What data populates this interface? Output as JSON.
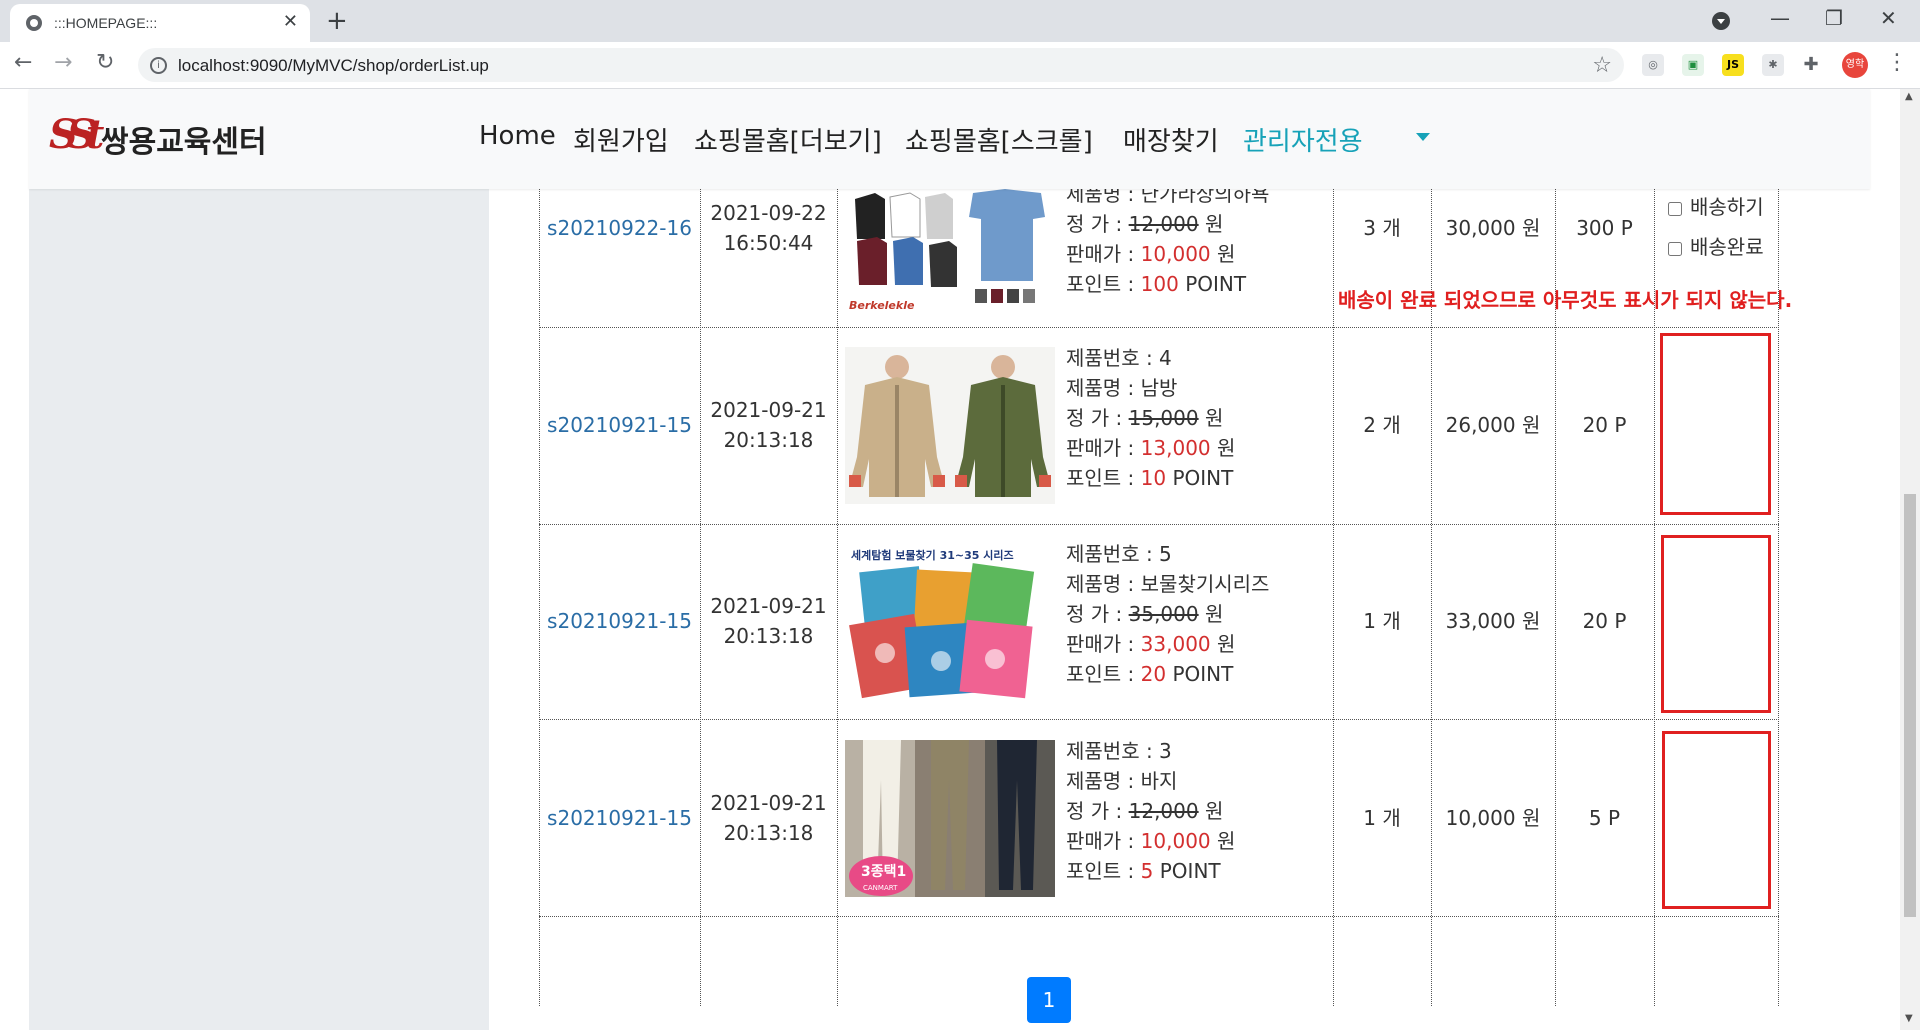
{
  "browser": {
    "tab_title": ":::HOMEPAGE:::",
    "url": "localhost:9090/MyMVC/shop/orderList.up",
    "profile_label": "영학",
    "ext_js_label": "JS"
  },
  "site": {
    "logo_text": "쌍용교육센터",
    "nav": [
      "Home",
      "회원가입",
      "쇼핑몰홈[더보기]",
      "쇼핑몰홈[스크롤]",
      "매장찾기",
      "관리자전용"
    ]
  },
  "orders": [
    {
      "code": "s20210922-16",
      "date": "2021-09-22",
      "time": "16:50:44",
      "image": "tshirts",
      "product_name_line": "제품명 : 난가라상의하욕",
      "price_label": "정 가 : ",
      "price": "12,000",
      "sale_label": "판매가 : ",
      "sale_price": "10,000",
      "won": " 원",
      "point_label": "포인트 : ",
      "point": "100",
      "point_unit": " POINT",
      "qty": "3 개",
      "total": "30,000 원",
      "order_point": "300 P"
    },
    {
      "code": "s20210921-15",
      "date": "2021-09-21",
      "time": "20:13:18",
      "image": "jackets",
      "product_no_line": "제품번호 : 4",
      "product_name_line": "제품명 : 남방",
      "price_label": "정 가 : ",
      "price": "15,000",
      "sale_label": "판매가 : ",
      "sale_price": "13,000",
      "won": " 원",
      "point_label": "포인트 : ",
      "point": "10",
      "point_unit": " POINT",
      "qty": "2 개",
      "total": "26,000 원",
      "order_point": "20 P"
    },
    {
      "code": "s20210921-15",
      "date": "2021-09-21",
      "time": "20:13:18",
      "image": "books",
      "product_no_line": "제품번호 : 5",
      "product_name_line": "제품명 : 보물찾기시리즈",
      "price_label": "정 가 : ",
      "price": "35,000",
      "sale_label": "판매가 : ",
      "sale_price": "33,000",
      "won": " 원",
      "point_label": "포인트 : ",
      "point": "20",
      "point_unit": " POINT",
      "qty": "1 개",
      "total": "33,000 원",
      "order_point": "20 P"
    },
    {
      "code": "s20210921-15",
      "date": "2021-09-21",
      "time": "20:13:18",
      "image": "pants",
      "product_no_line": "제품번호 : 3",
      "product_name_line": "제품명 : 바지",
      "price_label": "정 가 : ",
      "price": "12,000",
      "sale_label": "판매가 : ",
      "sale_price": "10,000",
      "won": " 원",
      "point_label": "포인트 : ",
      "point": "5",
      "point_unit": " POINT",
      "qty": "1 개",
      "total": "10,000 원",
      "order_point": "5 P"
    }
  ],
  "delivery": {
    "ship_label": "배송하기",
    "done_label": "배송완료"
  },
  "notice": "배송이 완료 되었으므로 아무것도 표시가 되지 않는다.",
  "image_text": {
    "tshirt_brand": "Berkelekle",
    "books_title": "세계탐험 보물찾기 31~35 시리즈",
    "pants_badge": "3종택1",
    "pants_sub": "CANMART"
  },
  "pagination": {
    "current": "1"
  },
  "colors": {
    "accent": "#17a2b8",
    "primary": "#007bff",
    "price_red": "#d32f2f",
    "notice_red": "#e01f1f"
  }
}
